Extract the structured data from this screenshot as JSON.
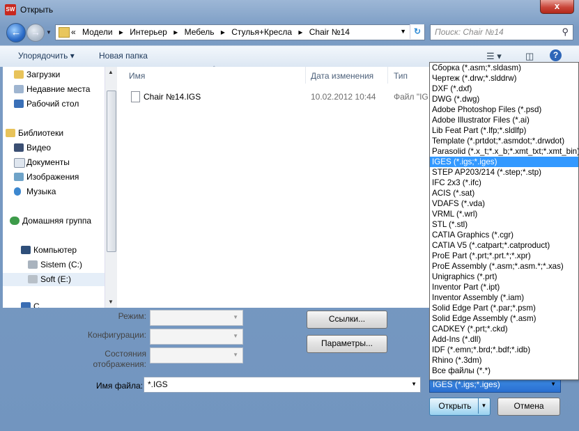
{
  "window": {
    "title": "Открыть",
    "close_glyph": "x",
    "app_icon_text": "SW"
  },
  "address": {
    "crumbs": [
      "«",
      "Модели",
      "▸",
      "Интерьер",
      "▸",
      "Мебель",
      "▸",
      "Стулья+Кресла",
      "▸",
      "Chair №14"
    ],
    "search_placeholder": "Поиск: Chair №14"
  },
  "toolbar": {
    "organize": "Упорядочить ▾",
    "new_folder": "Новая папка"
  },
  "nav": {
    "items": [
      "Загрузки",
      "Недавние места",
      "Рабочий стол",
      "Библиотеки",
      "Видео",
      "Документы",
      "Изображения",
      "Музыка",
      "Домашняя группа",
      "Компьютер",
      "Sistem (C:)",
      "Soft (E:)",
      "С..."
    ]
  },
  "files": {
    "headers": {
      "name": "Имя",
      "date": "Дата изменения",
      "type": "Тип"
    },
    "rows": [
      {
        "name": "Chair №14.IGS",
        "date": "10.02.2012 10:44",
        "type": "Файл \"IG"
      }
    ]
  },
  "lower": {
    "mode_label": "Режим:",
    "config_label": "Конфигурации:",
    "states_label_1": "Состояния",
    "states_label_2": "отображения:",
    "links_button": "Ссылки...",
    "params_button": "Параметры...",
    "filename_label": "Имя файла:",
    "filename_value": "*.IGS",
    "filter_value": "IGES (*.igs;*.iges)",
    "open_button": "Открыть",
    "cancel_button": "Отмена"
  },
  "filter_options": [
    "Сборка (*.asm;*.sldasm)",
    "Чертеж (*.drw;*.slddrw)",
    "DXF (*.dxf)",
    "DWG (*.dwg)",
    "Adobe Photoshop Files (*.psd)",
    "Adobe Illustrator Files (*.ai)",
    "Lib Feat Part (*.lfp;*.sldlfp)",
    "Template (*.prtdot;*.asmdot;*.drwdot)",
    "Parasolid (*.x_t;*.x_b;*.xmt_txt;*.xmt_bin)",
    "IGES (*.igs;*.iges)",
    "STEP AP203/214 (*.step;*.stp)",
    "IFC 2x3 (*.ifc)",
    "ACIS (*.sat)",
    "VDAFS (*.vda)",
    "VRML (*.wrl)",
    "STL (*.stl)",
    "CATIA Graphics (*.cgr)",
    "CATIA V5 (*.catpart;*.catproduct)",
    "ProE Part (*.prt;*.prt.*;*.xpr)",
    "ProE Assembly (*.asm;*.asm.*;*.xas)",
    "Unigraphics (*.prt)",
    "Inventor Part (*.ipt)",
    "Inventor Assembly (*.iam)",
    "Solid Edge Part (*.par;*.psm)",
    "Solid Edge Assembly (*.asm)",
    "CADKEY (*.prt;*.ckd)",
    "Add-Ins (*.dll)",
    "IDF (*.emn;*.brd;*.bdf;*.idb)",
    "Rhino (*.3dm)",
    "Все файлы (*.*)"
  ],
  "selected_filter_index": 9,
  "colors": {
    "selection": "#3399ff",
    "frame": "#7b9cc4"
  }
}
